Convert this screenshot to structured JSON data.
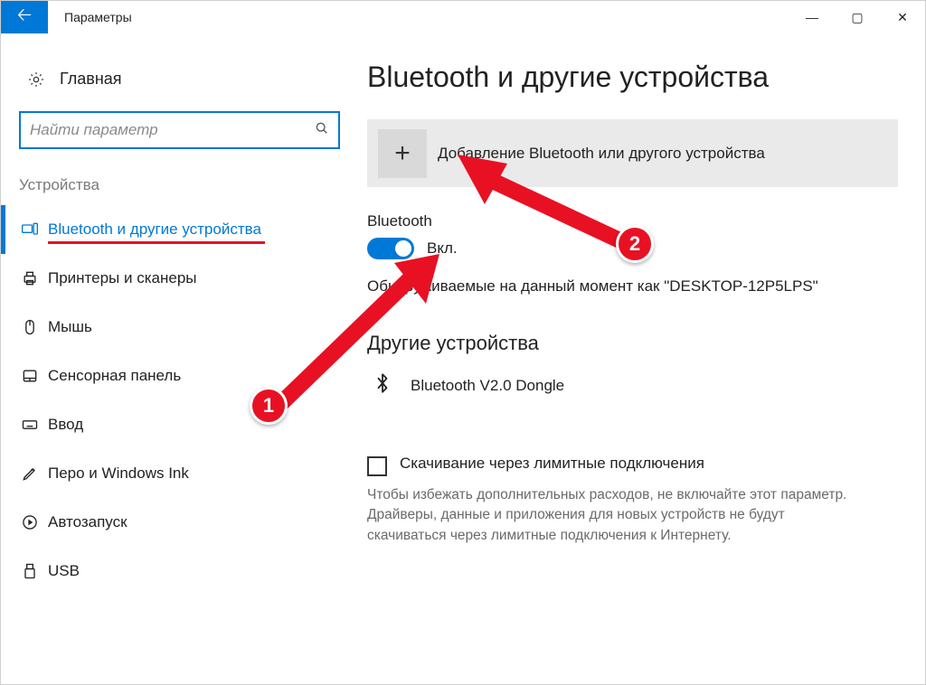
{
  "window": {
    "title": "Параметры"
  },
  "sidebar": {
    "home_label": "Главная",
    "search_placeholder": "Найти параметр",
    "group_label": "Устройства",
    "items": [
      {
        "label": "Bluetooth и другие устройства"
      },
      {
        "label": "Принтеры и сканеры"
      },
      {
        "label": "Мышь"
      },
      {
        "label": "Сенсорная панель"
      },
      {
        "label": "Ввод"
      },
      {
        "label": "Перо и Windows Ink"
      },
      {
        "label": "Автозапуск"
      },
      {
        "label": "USB"
      }
    ]
  },
  "main": {
    "page_title": "Bluetooth и другие устройства",
    "add_device_label": "Добавление Bluetooth или другого устройства",
    "bt_section_label": "Bluetooth",
    "bt_toggle_state": "Вкл.",
    "discoverable_text": "Обнаруживаемые на данный момент как \"DESKTOP-12P5LPS\"",
    "other_devices_heading": "Другие устройства",
    "devices": [
      {
        "name": "Bluetooth V2.0 Dongle"
      }
    ],
    "metered_checkbox_label": "Скачивание через лимитные подключения",
    "metered_help": "Чтобы избежать дополнительных расходов, не включайте этот параметр. Драйверы, данные и приложения для новых устройств не будут скачиваться через лимитные подключения к Интернету."
  },
  "annotations": {
    "badge1": "1",
    "badge2": "2"
  }
}
